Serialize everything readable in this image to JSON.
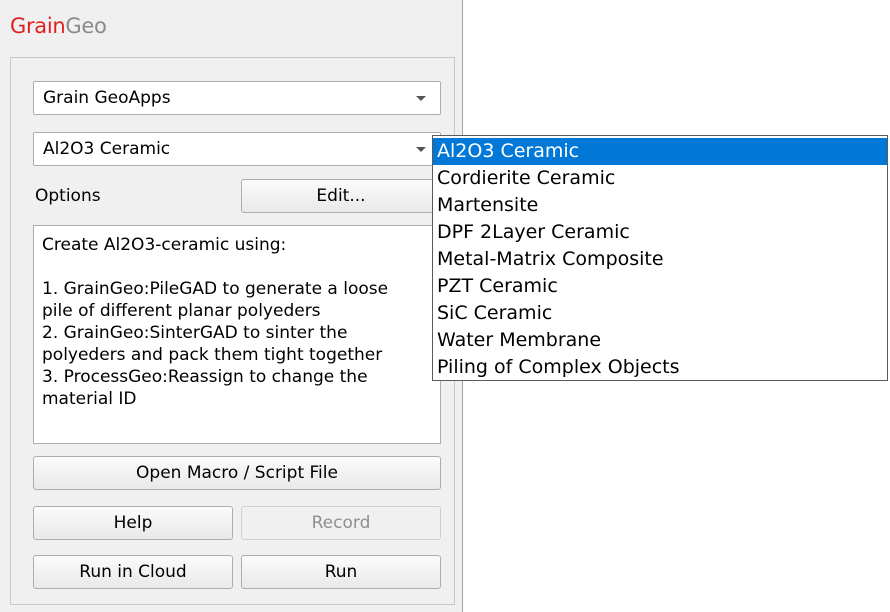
{
  "app": {
    "title_part1": "Grain",
    "title_part2": "Geo"
  },
  "combo_category": {
    "value": "Grain GeoApps"
  },
  "combo_app": {
    "value": "Al2O3 Ceramic"
  },
  "options": {
    "label": "Options",
    "edit_button": "Edit..."
  },
  "description": {
    "line1": "Create Al2O3-ceramic using:",
    "line2": "1. GrainGeo:PileGAD to generate a loose",
    "line3": "pile of different planar polyeders",
    "line4": "2. GrainGeo:SinterGAD to sinter the",
    "line5": "polyeders and pack them tight together",
    "line6": "3. ProcessGeo:Reassign to change the",
    "line7": "material ID"
  },
  "buttons": {
    "open_macro": "Open Macro / Script File",
    "help": "Help",
    "record": "Record",
    "run_cloud": "Run in Cloud",
    "run": "Run"
  },
  "dropdown": {
    "items": [
      "Al2O3 Ceramic",
      "Cordierite Ceramic",
      "Martensite",
      "DPF 2Layer Ceramic",
      "Metal-Matrix Composite",
      "PZT Ceramic",
      "SiC Ceramic",
      "Water Membrane",
      "Piling of Complex Objects"
    ],
    "selected_index": 0
  },
  "colors": {
    "accent": "#0078d7",
    "title_red": "#e02020",
    "title_gray": "#8a8a8a"
  }
}
